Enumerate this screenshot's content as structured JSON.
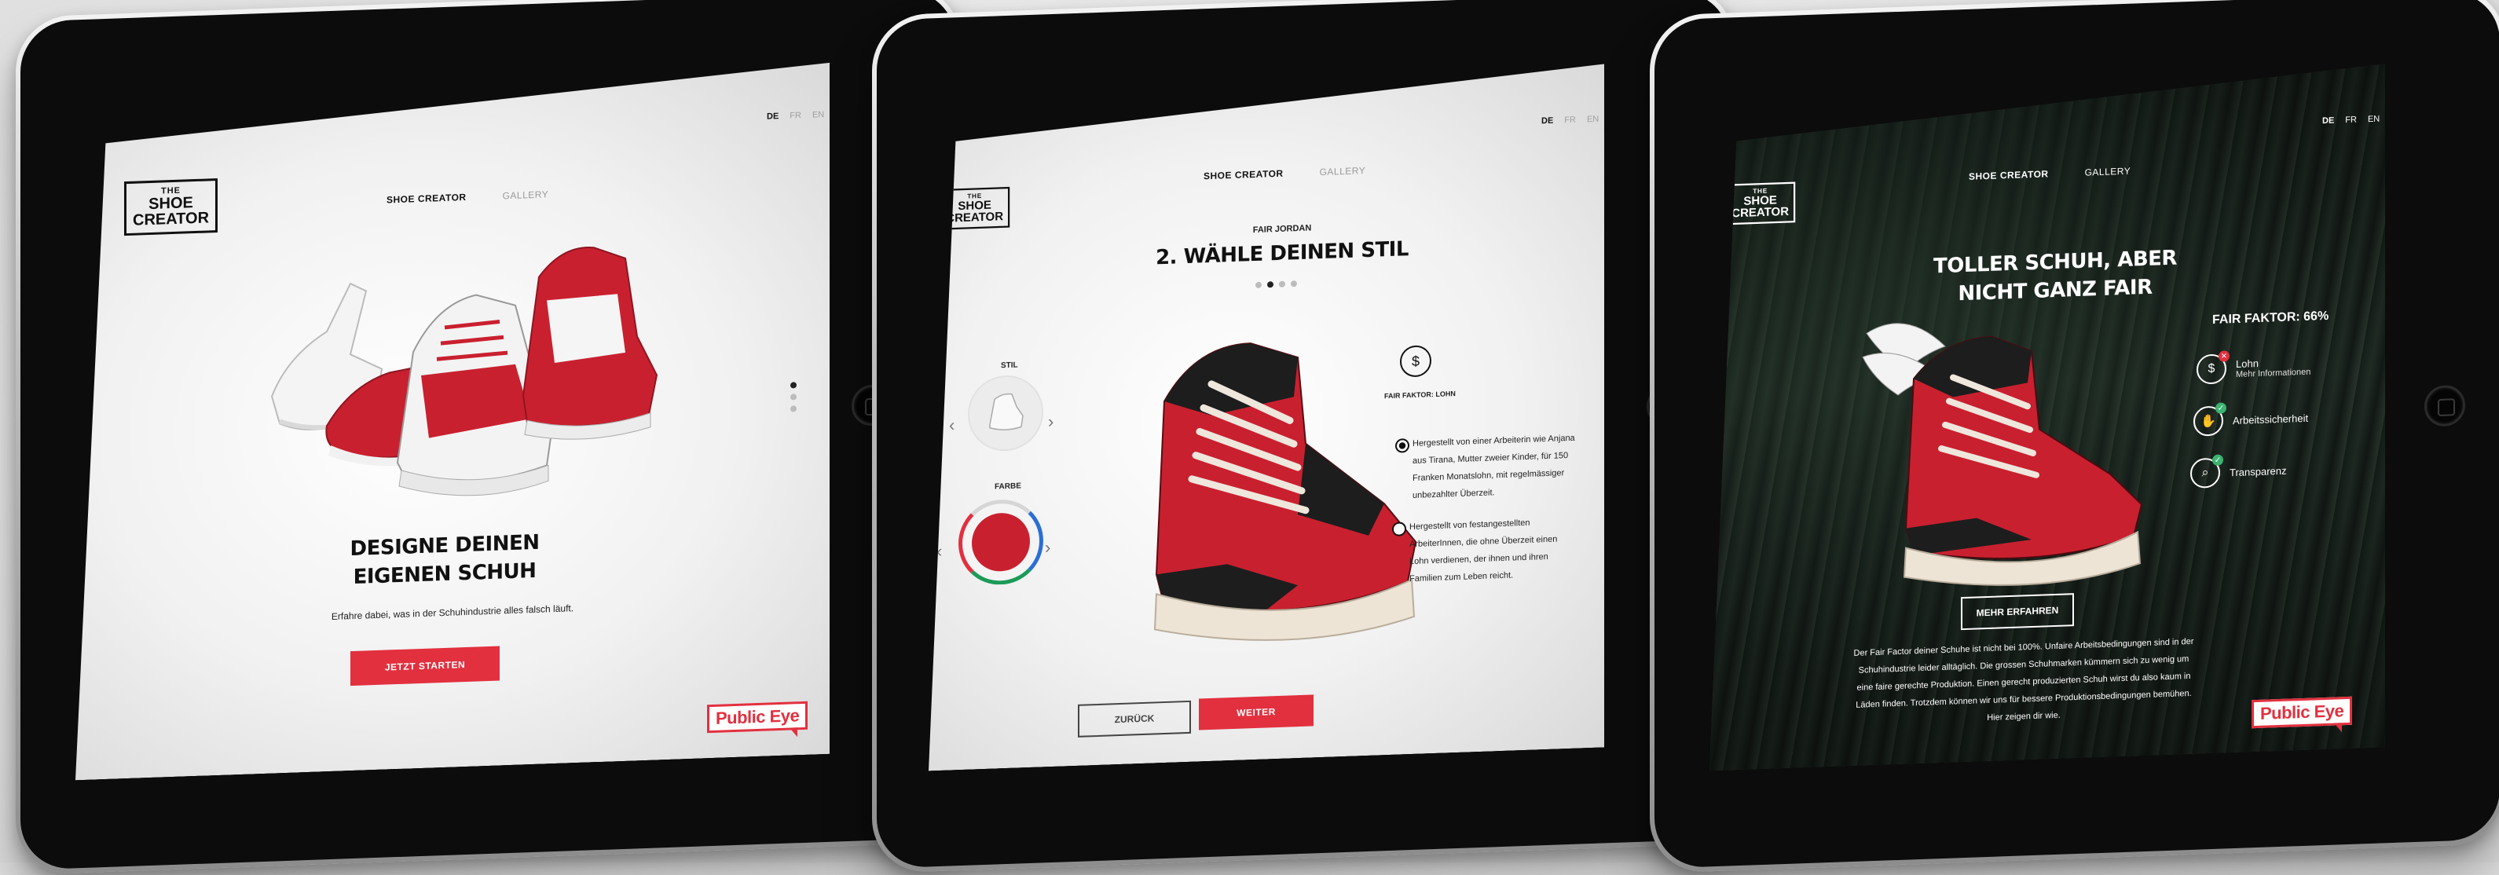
{
  "colors": {
    "accent": "#e2303f",
    "bezel": "#0c0c0c",
    "text": "#111111"
  },
  "screen1": {
    "logo": {
      "line1": "THE",
      "line2": "SHOE",
      "line3": "CREATOR"
    },
    "nav": {
      "active": "SHOE CREATOR",
      "inactive": "GALLERY"
    },
    "lang": [
      "DE",
      "FR",
      "EN"
    ],
    "headline_1": "DESIGNE DEINEN",
    "headline_2": "EIGENEN SCHUH",
    "subtext": "Erfahre dabei, was in der Schuhindustrie alles falsch läuft.",
    "cta": "JETZT STARTEN",
    "brand": "Public Eye"
  },
  "screen2": {
    "logo": {
      "line1": "THE",
      "line2": "SHOE",
      "line3": "CREATOR"
    },
    "nav": {
      "active": "SHOE CREATOR",
      "inactive": "GALLERY"
    },
    "lang": [
      "DE",
      "FR",
      "EN"
    ],
    "kicker": "FAIR JORDAN",
    "headline": "2. WÄHLE DEINEN STIL",
    "style_label": "STIL",
    "color_label": "FARBE",
    "fair_factor_icon": "dollar-icon",
    "fair_factor_label": "FAIR FAKTOR: LOHN",
    "option1": "Hergestellt von einer Arbeiterin wie Anjana aus Tirana, Mutter zweier Kinder, für 150 Franken Monatslohn, mit regelmässiger unbezahlter Überzeit.",
    "option2": "Hergestellt von festangestellten ArbeiterInnen, die ohne Überzeit einen Lohn verdienen, der ihnen und ihren Familien zum Leben reicht.",
    "back": "ZURÜCK",
    "next": "WEITER"
  },
  "screen3": {
    "logo": {
      "line1": "THE",
      "line2": "SHOE",
      "line3": "CREATOR"
    },
    "nav": {
      "active": "SHOE CREATOR",
      "inactive": "GALLERY"
    },
    "lang": [
      "DE",
      "FR",
      "EN"
    ],
    "headline_1": "TOLLER SCHUH, ABER",
    "headline_2": "NICHT GANZ FAIR",
    "fair_factor": "FAIR FAKTOR: 66%",
    "items": [
      {
        "icon": "dollar-icon",
        "label": "Lohn",
        "sub": "Mehr Informationen",
        "status": "fail"
      },
      {
        "icon": "hand-icon",
        "label": "Arbeitssicherheit",
        "sub": "",
        "status": "pass"
      },
      {
        "icon": "magnifier-icon",
        "label": "Transparenz",
        "sub": "",
        "status": "pass"
      }
    ],
    "more": "MEHR ERFAHREN",
    "body": "Der Fair Factor deiner Schuhe ist nicht bei 100%. Unfaire Arbeitsbedingungen sind in der Schuhindustrie leider alltäglich. Die grossen Schuhmarken kümmern sich zu wenig um eine faire gerechte Produktion. Einen gerecht produzierten Schuh wirst du also kaum in Läden finden. Trotzdem können wir uns für bessere Produktionsbedingungen bemühen. Hier zeigen dir wie.",
    "brand": "Public Eye"
  }
}
